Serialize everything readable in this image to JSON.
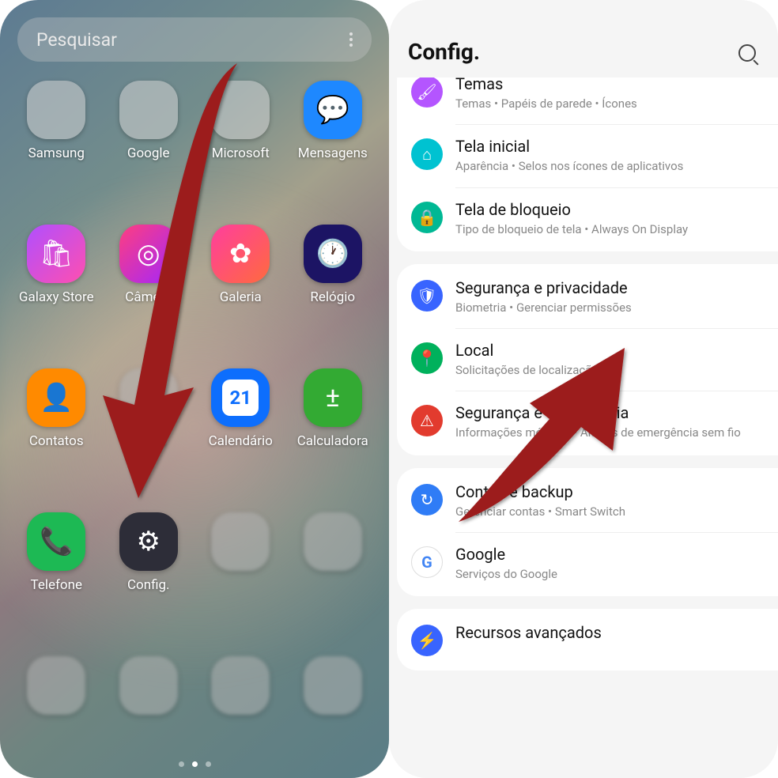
{
  "left": {
    "search_placeholder": "Pesquisar",
    "apps": [
      {
        "label": "Samsung",
        "type": "folder",
        "colors": [
          "#ffb300",
          "#ff6f00",
          "#1565c0",
          "#00b0ff",
          "#43a047",
          "#8e24aa",
          "#757575",
          "#00897b",
          "#d81b60"
        ]
      },
      {
        "label": "Google",
        "type": "folder",
        "colors": [
          "#4285f4",
          "#ea4335",
          "#fbbc05",
          "#34a853",
          "#a142f4",
          "#4285f4",
          "#1a73e8",
          "#0f9d58",
          "#f4b400"
        ]
      },
      {
        "label": "Microsoft",
        "type": "folder",
        "colors": [
          "#29b6f6",
          "#0d47a1",
          "#00e5ff",
          "#ffab00",
          "#757575",
          "#455a64",
          "#607d8b",
          "#90a4ae",
          "#cfd8dc"
        ]
      },
      {
        "label": "Mensagens",
        "type": "app",
        "bg": "#1e88ff",
        "glyph": "💬"
      },
      {
        "label": "Galaxy Store",
        "type": "app",
        "bg": "linear-gradient(135deg,#b04fff,#ff4fb0)",
        "glyph": "🛍"
      },
      {
        "label": "Câmera",
        "type": "app",
        "bg": "linear-gradient(135deg,#ff3e7f,#a126ff)",
        "glyph": "◎"
      },
      {
        "label": "Galeria",
        "type": "app",
        "bg": "linear-gradient(135deg,#ff3e9e,#ff6a3e)",
        "glyph": "✿"
      },
      {
        "label": "Relógio",
        "type": "app",
        "bg": "#1c1464",
        "glyph": "🕐"
      },
      {
        "label": "Contatos",
        "type": "app",
        "bg": "#ff8a00",
        "glyph": "👤"
      },
      {
        "label": "Notas",
        "type": "blur",
        "bg": ""
      },
      {
        "label": "Calendário",
        "type": "app",
        "bg": "#0d6efd",
        "glyph": "21",
        "sq": true
      },
      {
        "label": "Calculadora",
        "type": "app",
        "bg": "#33aa33",
        "glyph": "±"
      },
      {
        "label": "Telefone",
        "type": "app",
        "bg": "#1db954",
        "glyph": "📞"
      },
      {
        "label": "Config.",
        "type": "app",
        "bg": "#2d2d38",
        "glyph": "⚙"
      },
      {
        "label": "",
        "type": "blur",
        "bg": ""
      },
      {
        "label": "",
        "type": "blur",
        "bg": ""
      },
      {
        "label": "",
        "type": "blur",
        "bg": ""
      },
      {
        "label": "",
        "type": "blur",
        "bg": ""
      },
      {
        "label": "",
        "type": "blur",
        "bg": ""
      },
      {
        "label": "",
        "type": "blur",
        "bg": ""
      }
    ]
  },
  "right": {
    "title": "Config.",
    "groups": [
      [
        {
          "title": "Temas",
          "sub": "Temas • Papéis de parede • Ícones",
          "color": "#b455ff",
          "glyph": "🖌"
        },
        {
          "title": "Tela inicial",
          "sub": "Aparência • Selos nos ícones de aplicativos",
          "color": "#00c2d1",
          "glyph": "⌂"
        },
        {
          "title": "Tela de bloqueio",
          "sub": "Tipo de bloqueio de tela • Always On Display",
          "color": "#00b894",
          "glyph": "🔒"
        }
      ],
      [
        {
          "title": "Segurança e privacidade",
          "sub": "Biometria • Gerenciar permissões",
          "color": "#3864ff",
          "glyph": "🛡"
        },
        {
          "title": "Local",
          "sub": "Solicitações de localização",
          "color": "#00b15c",
          "glyph": "📍"
        },
        {
          "title": "Segurança e emergência",
          "sub": "Informações médicas • Alertas de emergência sem fio",
          "color": "#e23b2e",
          "glyph": "⚠"
        }
      ],
      [
        {
          "title": "Contas e backup",
          "sub": "Gerenciar contas • Smart Switch",
          "color": "#2f7cf6",
          "glyph": "↻"
        },
        {
          "title": "Google",
          "sub": "Serviços do Google",
          "color": "#ffffff",
          "glyph": "G",
          "gcolor": "#4285f4"
        }
      ],
      [
        {
          "title": "Recursos avançados",
          "sub": "",
          "color": "#3864ff",
          "glyph": "⚡"
        }
      ]
    ]
  }
}
